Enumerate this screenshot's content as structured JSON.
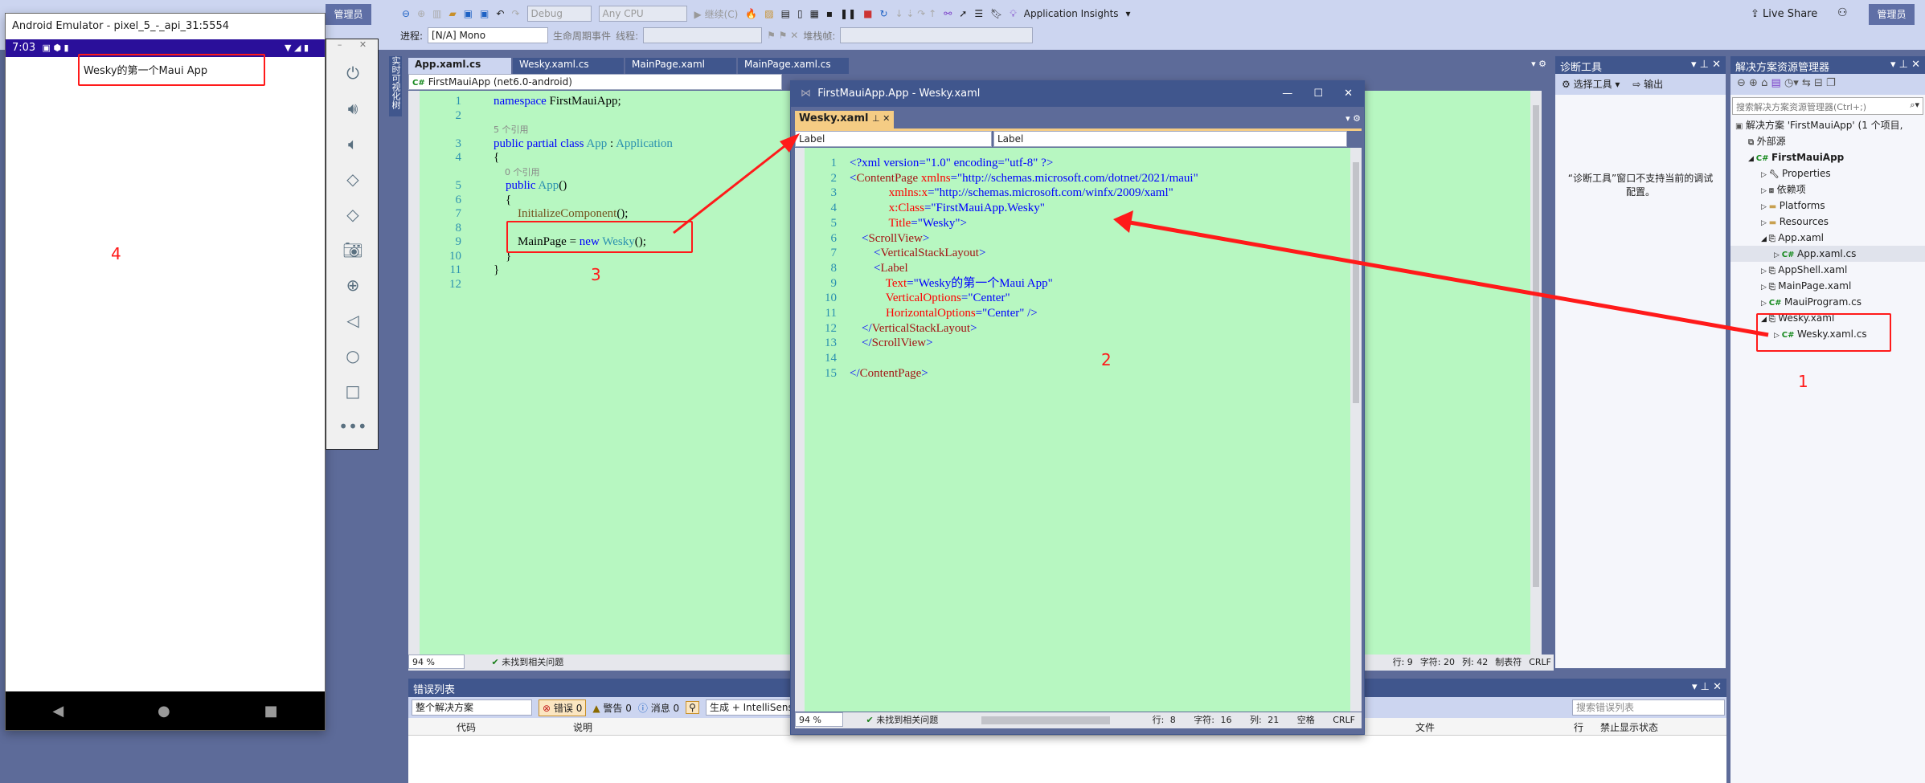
{
  "vs": {
    "toolbar": {
      "config": "Debug",
      "platform": "Any CPU",
      "continue": "继续(C)",
      "app_insights": "Application Insights",
      "live_share": "Live Share",
      "admin": "管理员",
      "process_label": "进程:",
      "process_value": "[N/A] Mono",
      "lifecycle": "生命周期事件",
      "thread_label": "线程:",
      "stackframe_label": "堆栈帧:"
    },
    "vertical_tab": "实时可视化树",
    "editor": {
      "tabs": [
        {
          "label": "App.xaml.cs",
          "active": true
        },
        {
          "label": "Wesky.xaml.cs"
        },
        {
          "label": "MainPage.xaml"
        },
        {
          "label": "MainPage.xaml.cs"
        }
      ],
      "nav_project": "FirstMauiApp (net6.0-android)",
      "lines": [
        {
          "n": "1",
          "t": [
            [
              "namespace ",
              "kw"
            ],
            [
              "FirstMauiApp;",
              "tx"
            ]
          ]
        },
        {
          "n": "2",
          "t": []
        },
        {
          "n": "",
          "t": [
            [
              "5 个引用",
              "lens"
            ]
          ]
        },
        {
          "n": "3",
          "t": [
            [
              "public partial class ",
              "kw"
            ],
            [
              "App",
              "ty"
            ],
            [
              " : ",
              "tx"
            ],
            [
              "Application",
              "ty"
            ]
          ]
        },
        {
          "n": "4",
          "t": [
            [
              "{",
              "tx"
            ]
          ]
        },
        {
          "n": "",
          "t": [
            [
              "    0 个引用",
              "lens"
            ]
          ]
        },
        {
          "n": "5",
          "t": [
            [
              "    public ",
              "kw"
            ],
            [
              "App",
              "ty"
            ],
            [
              "()",
              "tx"
            ]
          ]
        },
        {
          "n": "6",
          "t": [
            [
              "    {",
              "tx"
            ]
          ]
        },
        {
          "n": "7",
          "t": [
            [
              "        InitializeComponent",
              "mt"
            ],
            [
              "();",
              "tx"
            ]
          ]
        },
        {
          "n": "8",
          "t": []
        },
        {
          "n": "9",
          "t": [
            [
              "        MainPage = ",
              "tx"
            ],
            [
              "new ",
              "kw"
            ],
            [
              "Wesky",
              "ty"
            ],
            [
              "();",
              "tx"
            ]
          ]
        },
        {
          "n": "10",
          "t": [
            [
              "    }",
              "tx"
            ]
          ]
        },
        {
          "n": "11",
          "t": [
            [
              "}",
              "tx"
            ]
          ]
        },
        {
          "n": "12",
          "t": []
        }
      ],
      "zoom": "94 %",
      "issues": "未找到相关问题",
      "line": "行: 9",
      "char": "字符: 20",
      "col": "列: 42",
      "indent": "制表符",
      "eol": "CRLF"
    },
    "diagnostics": {
      "title": "诊断工具",
      "select_tools": "选择工具",
      "output": "输出",
      "message": "“诊断工具”窗口不支持当前的调试配置。"
    },
    "solution_explorer": {
      "title": "解决方案资源管理器",
      "search_placeholder": "搜索解决方案资源管理器(Ctrl+;)",
      "items": [
        {
          "label": "解决方案 'FirstMauiApp' (1 个项目,",
          "icon": "solution-icon",
          "indent": 0
        },
        {
          "label": "外部源",
          "icon": "external-source-icon",
          "indent": 1
        },
        {
          "label": "FirstMauiApp",
          "icon": "csharp-project-icon",
          "indent": 1,
          "bold": true,
          "expanded": true
        },
        {
          "label": "Properties",
          "icon": "properties-icon",
          "indent": 2
        },
        {
          "label": "依赖项",
          "icon": "dependencies-icon",
          "indent": 2
        },
        {
          "label": "Platforms",
          "icon": "folder-icon",
          "indent": 2
        },
        {
          "label": "Resources",
          "icon": "folder-icon",
          "indent": 2
        },
        {
          "label": "App.xaml",
          "icon": "xaml-file-icon",
          "indent": 2,
          "expanded": true
        },
        {
          "label": "App.xaml.cs",
          "icon": "csharp-file-icon",
          "indent": 3,
          "selected": true
        },
        {
          "label": "AppShell.xaml",
          "icon": "xaml-file-icon",
          "indent": 2
        },
        {
          "label": "MainPage.xaml",
          "icon": "xaml-file-icon",
          "indent": 2
        },
        {
          "label": "MauiProgram.cs",
          "icon": "csharp-file-icon",
          "indent": 2
        },
        {
          "label": "Wesky.xaml",
          "icon": "xaml-file-icon",
          "indent": 2,
          "expanded": true
        },
        {
          "label": "Wesky.xaml.cs",
          "icon": "csharp-file-icon",
          "indent": 3
        }
      ]
    },
    "error_list": {
      "title": "错误列表",
      "scope": "整个解决方案",
      "errors": "错误 0",
      "warnings": "警告 0",
      "messages": "消息 0",
      "build": "生成 + IntelliSense",
      "search_placeholder": "搜索错误列表",
      "columns": [
        "代码",
        "说明",
        "文件",
        "行",
        "禁止显示状态"
      ]
    }
  },
  "floating": {
    "title": "FirstMauiApp.App - Wesky.xaml",
    "tab": "Wesky.xaml",
    "nav_left": "Label",
    "nav_right": "Label",
    "lines": [
      {
        "n": "1",
        "t": [
          [
            "<?xml version=\"1.0\" encoding=\"utf-8\" ?>",
            "val"
          ]
        ]
      },
      {
        "n": "2",
        "t": [
          [
            "<",
            "val"
          ],
          [
            "ContentPage ",
            "tag"
          ],
          [
            "xmlns",
            "at"
          ],
          [
            "=\"http://schemas.microsoft.com/dotnet/2021/maui\"",
            "val"
          ]
        ]
      },
      {
        "n": "3",
        "t": [
          [
            "             xmlns:x",
            "at"
          ],
          [
            "=\"http://schemas.microsoft.com/winfx/2009/xaml\"",
            "val"
          ]
        ]
      },
      {
        "n": "4",
        "t": [
          [
            "             x:Class",
            "at"
          ],
          [
            "=\"FirstMauiApp.Wesky\"",
            "val"
          ]
        ]
      },
      {
        "n": "5",
        "t": [
          [
            "             Title",
            "at"
          ],
          [
            "=\"Wesky\">",
            "val"
          ]
        ]
      },
      {
        "n": "6",
        "t": [
          [
            "    <",
            "val"
          ],
          [
            "ScrollView",
            "tag"
          ],
          [
            ">",
            "val"
          ]
        ]
      },
      {
        "n": "7",
        "t": [
          [
            "        <",
            "val"
          ],
          [
            "VerticalStackLayout",
            "tag"
          ],
          [
            ">",
            "val"
          ]
        ]
      },
      {
        "n": "8",
        "t": [
          [
            "        <",
            "val"
          ],
          [
            "Label",
            "tag"
          ]
        ]
      },
      {
        "n": "9",
        "t": [
          [
            "            Text",
            "at"
          ],
          [
            "=\"Wesky的第一个Maui App\"",
            "val"
          ]
        ]
      },
      {
        "n": "10",
        "t": [
          [
            "            VerticalOptions",
            "at"
          ],
          [
            "=\"Center\"",
            "val"
          ]
        ]
      },
      {
        "n": "11",
        "t": [
          [
            "            HorizontalOptions",
            "at"
          ],
          [
            "=\"Center\" />",
            "val"
          ]
        ]
      },
      {
        "n": "12",
        "t": [
          [
            "    </",
            "val"
          ],
          [
            "VerticalStackLayout",
            "tag"
          ],
          [
            ">",
            "val"
          ]
        ]
      },
      {
        "n": "13",
        "t": [
          [
            "    </",
            "val"
          ],
          [
            "ScrollView",
            "tag"
          ],
          [
            ">",
            "val"
          ]
        ]
      },
      {
        "n": "14",
        "t": []
      },
      {
        "n": "15",
        "t": [
          [
            "</",
            "val"
          ],
          [
            "ContentPage",
            "tag"
          ],
          [
            ">",
            "val"
          ]
        ]
      }
    ],
    "zoom": "94 %",
    "issues": "未找到相关问题",
    "line": "行: 8",
    "char": "字符: 16",
    "col": "列: 21",
    "indent": "空格",
    "eol": "CRLF"
  },
  "emulator": {
    "title": "Android Emulator - pixel_5_-_api_31:5554",
    "time": "7:03",
    "label_text": "Wesky的第一个Maui App",
    "status_bar_color": "#2a0f9a"
  },
  "annotations": {
    "a1": "1",
    "a2": "2",
    "a3": "3",
    "a4": "4"
  },
  "colors": {
    "editor_bg": "#b7f7c1",
    "accent_tab": "#f5cc84",
    "frame": "#5d6b99",
    "annotation": "#ff1a1a"
  }
}
